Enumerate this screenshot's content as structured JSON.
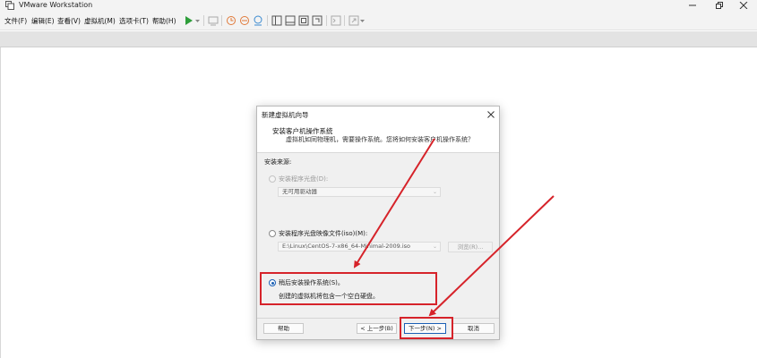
{
  "window": {
    "title": "VMware Workstation"
  },
  "menu": [
    {
      "key": "file",
      "label": "文件(F)"
    },
    {
      "key": "edit",
      "label": "编辑(E)"
    },
    {
      "key": "view",
      "label": "查看(V)"
    },
    {
      "key": "vm",
      "label": "虚拟机(M)"
    },
    {
      "key": "tabs",
      "label": "选项卡(T)"
    },
    {
      "key": "help",
      "label": "帮助(H)"
    }
  ],
  "toolbar_icons": [
    "play-icon",
    "send-keys-icon",
    "snapshot-icon",
    "revert-snapshot-icon",
    "snapshot-manager-icon",
    "sidebar-view-icon",
    "thumbnail-view-icon",
    "fullscreen-icon",
    "unity-icon",
    "console-icon",
    "stretch-icon"
  ],
  "colors": {
    "accent": "#1a5fb4",
    "highlight": "#d6232a",
    "play": "#2e9e3a"
  },
  "dialog": {
    "title": "新建虚拟机向导",
    "header_title": "安装客户机操作系统",
    "header_subtitle": "虚拟机如同物理机，需要操作系统。您将如何安装客户机操作系统？",
    "source_label": "安装来源:",
    "options": {
      "disc_label": "安装程序光盘(D):",
      "disc_value": "无可用驱动器",
      "iso_label": "安装程序光盘映像文件(iso)(M):",
      "iso_value": "E:\\Linux\\CentOS-7-x86_64-Minimal-2009.iso",
      "browse_label": "浏览(R)...",
      "later_label": "稍后安装操作系统(S)。",
      "later_desc": "创建的虚拟机将包含一个空白硬盘。",
      "selected": "later"
    },
    "buttons": {
      "help": "帮助",
      "back": "< 上一步(B)",
      "next": "下一步(N) >",
      "cancel": "取消"
    }
  }
}
